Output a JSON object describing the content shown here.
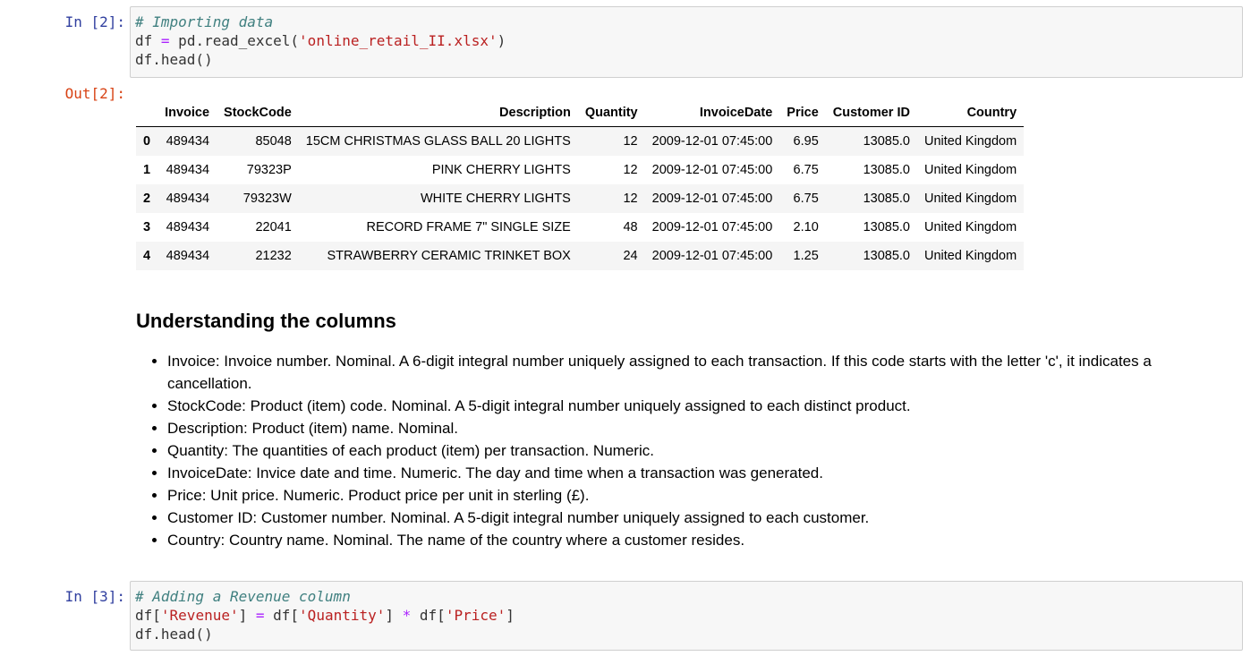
{
  "cell1": {
    "prompt": "In [2]:",
    "lines": {
      "l1_comment": "# Importing data",
      "l2_a": "df ",
      "l2_eq": "=",
      "l2_b": " pd.read_excel(",
      "l2_str": "'online_retail_II.xlsx'",
      "l2_c": ")",
      "l3": "df.head()"
    }
  },
  "output1": {
    "prompt": "Out[2]:",
    "table": {
      "columns": [
        "Invoice",
        "StockCode",
        "Description",
        "Quantity",
        "InvoiceDate",
        "Price",
        "Customer ID",
        "Country"
      ],
      "rows": [
        {
          "index": "0",
          "cells": [
            "489434",
            "85048",
            "15CM CHRISTMAS GLASS BALL 20 LIGHTS",
            "12",
            "2009-12-01 07:45:00",
            "6.95",
            "13085.0",
            "United Kingdom"
          ]
        },
        {
          "index": "1",
          "cells": [
            "489434",
            "79323P",
            "PINK CHERRY LIGHTS",
            "12",
            "2009-12-01 07:45:00",
            "6.75",
            "13085.0",
            "United Kingdom"
          ]
        },
        {
          "index": "2",
          "cells": [
            "489434",
            "79323W",
            "WHITE CHERRY LIGHTS",
            "12",
            "2009-12-01 07:45:00",
            "6.75",
            "13085.0",
            "United Kingdom"
          ]
        },
        {
          "index": "3",
          "cells": [
            "489434",
            "22041",
            "RECORD FRAME 7\" SINGLE SIZE",
            "48",
            "2009-12-01 07:45:00",
            "2.10",
            "13085.0",
            "United Kingdom"
          ]
        },
        {
          "index": "4",
          "cells": [
            "489434",
            "21232",
            "STRAWBERRY CERAMIC TRINKET BOX",
            "24",
            "2009-12-01 07:45:00",
            "1.25",
            "13085.0",
            "United Kingdom"
          ]
        }
      ]
    }
  },
  "markdown": {
    "heading": "Understanding the columns",
    "items": [
      "Invoice: Invoice number. Nominal. A 6-digit integral number uniquely assigned to each transaction. If this code starts with the letter 'c', it indicates a cancellation.",
      "StockCode: Product (item) code. Nominal. A 5-digit integral number uniquely assigned to each distinct product.",
      "Description: Product (item) name. Nominal.",
      "Quantity: The quantities of each product (item) per transaction. Numeric.",
      "InvoiceDate: Invice date and time. Numeric. The day and time when a transaction was generated.",
      "Price: Unit price. Numeric. Product price per unit in sterling (£).",
      "Customer ID: Customer number. Nominal. A 5-digit integral number uniquely assigned to each customer.",
      "Country: Country name. Nominal. The name of the country where a customer resides."
    ]
  },
  "cell2": {
    "prompt": "In [3]:",
    "lines": {
      "l1_comment": "# Adding a Revenue column",
      "l2_a": "df[",
      "l2_s1": "'Revenue'",
      "l2_b": "] ",
      "l2_eq": "=",
      "l2_c": " df[",
      "l2_s2": "'Quantity'",
      "l2_d": "] ",
      "l2_mul": "*",
      "l2_e": " df[",
      "l2_s3": "'Price'",
      "l2_f": "]",
      "l3": "df.head()"
    }
  },
  "colors": {
    "in_prompt": "#303f9f",
    "out_prompt": "#d84315",
    "comment": "#408080",
    "string": "#ba2121",
    "operator": "#aa22ff",
    "code_bg": "#f7f7f7",
    "row_stripe": "#f5f5f5"
  }
}
